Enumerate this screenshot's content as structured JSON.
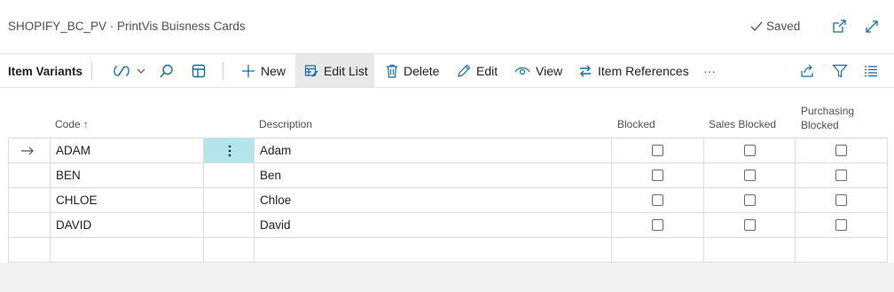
{
  "window": {
    "title": "SHOPIFY_BC_PV · PrintVis Buisness Cards",
    "saved_label": "Saved"
  },
  "actionbar": {
    "section_title": "Item Variants",
    "new_label": "New",
    "edit_list_label": "Edit List",
    "delete_label": "Delete",
    "edit_label": "Edit",
    "view_label": "View",
    "item_references_label": "Item References",
    "more_label": "···"
  },
  "table": {
    "columns": {
      "code": "Code ↑",
      "description": "Description",
      "blocked": "Blocked",
      "sales_blocked": "Sales Blocked",
      "purchasing_blocked_1": "Purchasing",
      "purchasing_blocked_2": "Blocked"
    },
    "rows": [
      {
        "code": "ADAM",
        "description": "Adam",
        "blocked": false,
        "sales_blocked": false,
        "purchasing_blocked": false,
        "selected": true
      },
      {
        "code": "BEN",
        "description": "Ben",
        "blocked": false,
        "sales_blocked": false,
        "purchasing_blocked": false
      },
      {
        "code": "CHLOE",
        "description": "Chloe",
        "blocked": false,
        "sales_blocked": false,
        "purchasing_blocked": false
      },
      {
        "code": "DAVID",
        "description": "David",
        "blocked": false,
        "sales_blocked": false,
        "purchasing_blocked": false
      }
    ]
  },
  "colors": {
    "accent": "#0e6fa8",
    "selected_cell": "#b3e5ea"
  }
}
